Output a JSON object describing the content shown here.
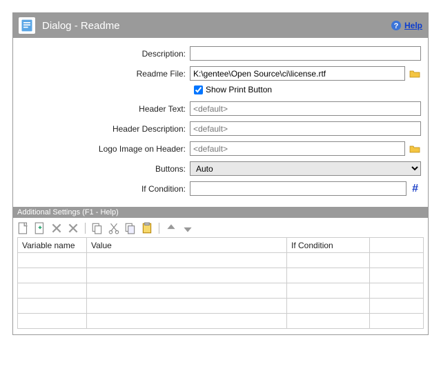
{
  "header": {
    "title": "Dialog - Readme",
    "help_label": "Help"
  },
  "form": {
    "description": {
      "label": "Description:",
      "value": ""
    },
    "readme_file": {
      "label": "Readme File:",
      "value": "K:\\gentee\\Open Source\\ci\\license.rtf"
    },
    "show_print": {
      "label": "Show Print Button",
      "checked": true
    },
    "header_text": {
      "label": "Header Text:",
      "value": "",
      "placeholder": "<default>"
    },
    "header_desc": {
      "label": "Header Description:",
      "value": "",
      "placeholder": "<default>"
    },
    "logo_image": {
      "label": "Logo Image on Header:",
      "value": "",
      "placeholder": "<default>"
    },
    "buttons": {
      "label": "Buttons:",
      "value": "Auto"
    },
    "if_condition": {
      "label": "If Condition:",
      "value": ""
    }
  },
  "additional": {
    "title": "Additional Settings (F1 - Help)",
    "columns": {
      "c1": "Variable name",
      "c2": "Value",
      "c3": "If Condition"
    }
  }
}
